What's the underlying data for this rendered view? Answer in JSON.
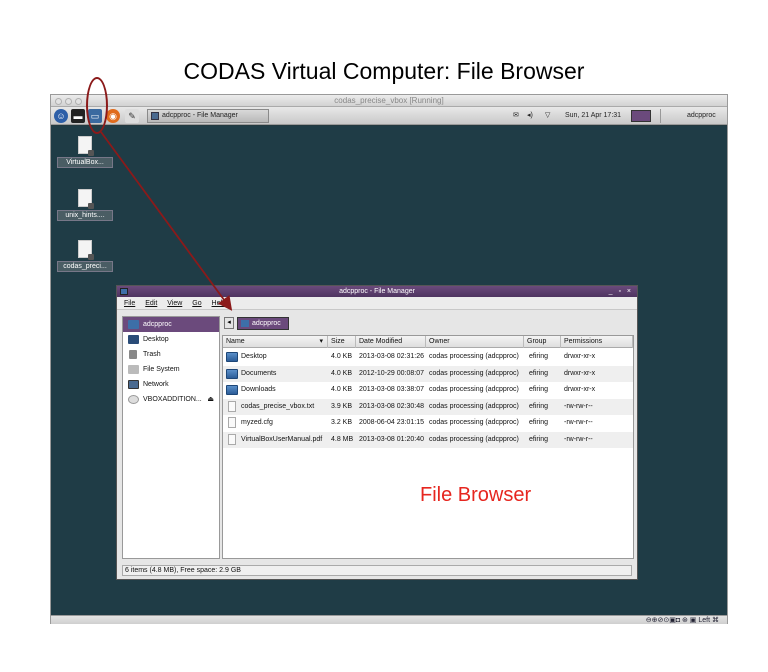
{
  "slide_title": "CODAS Virtual Computer: File Browser",
  "vbox": {
    "title": "codas_precise_vbox [Running]",
    "status_text": "Left ⌘"
  },
  "panel": {
    "task_button": "adcpproc - File Manager",
    "datetime": "Sun, 21 Apr 17:31",
    "user": "adcpproc"
  },
  "desktop_icons": [
    {
      "label": "VirtualBox..."
    },
    {
      "label": "unix_hints...."
    },
    {
      "label": "codas_preci..."
    }
  ],
  "file_manager": {
    "title": "adcpproc - File Manager",
    "window_controls": "_ ▫ ×",
    "menu": [
      "File",
      "Edit",
      "View",
      "Go",
      "Help"
    ],
    "back_glyph": "◂",
    "path_button": "adcpproc",
    "sidebar": [
      {
        "label": "adcpproc",
        "selected": true
      },
      {
        "label": "Desktop"
      },
      {
        "label": "Trash"
      },
      {
        "label": "File System"
      },
      {
        "label": "Network"
      },
      {
        "label": "VBOXADDITION...",
        "eject": "⏏"
      }
    ],
    "columns": [
      "Name",
      "Size",
      "Date Modified",
      "Owner",
      "Group",
      "Permissions"
    ],
    "sort_indicator": "▾",
    "files": [
      {
        "name": "Desktop",
        "type": "folder",
        "size": "4.0 KB",
        "modified": "2013-03-08 02:31:26",
        "owner": "codas processing (adcpproc)",
        "group": "efiring",
        "perms": "drwxr-xr-x"
      },
      {
        "name": "Documents",
        "type": "folder",
        "size": "4.0 KB",
        "modified": "2012-10-29 00:08:07",
        "owner": "codas processing (adcpproc)",
        "group": "efiring",
        "perms": "drwxr-xr-x"
      },
      {
        "name": "Downloads",
        "type": "folder",
        "size": "4.0 KB",
        "modified": "2013-03-08 03:38:07",
        "owner": "codas processing (adcpproc)",
        "group": "efiring",
        "perms": "drwxr-xr-x"
      },
      {
        "name": "codas_precise_vbox.txt",
        "type": "file",
        "size": "3.9 KB",
        "modified": "2013-03-08 02:30:48",
        "owner": "codas processing (adcpproc)",
        "group": "efiring",
        "perms": "-rw-rw-r--"
      },
      {
        "name": "myzed.cfg",
        "type": "file",
        "size": "3.2 KB",
        "modified": "2008-06-04 23:01:15",
        "owner": "codas processing (adcpproc)",
        "group": "efiring",
        "perms": "-rw-rw-r--"
      },
      {
        "name": "VirtualBoxUserManual.pdf",
        "type": "file",
        "size": "4.8 MB",
        "modified": "2013-03-08 01:20:40",
        "owner": "codas processing (adcpproc)",
        "group": "efiring",
        "perms": "-rw-rw-r--"
      }
    ],
    "statusbar": "6 items (4.8 MB), Free space: 2.9 GB"
  },
  "annotation": "File Browser",
  "colors": {
    "accent": "#6b4a7c",
    "desktop": "#1f3c46",
    "annotation": "#e6261f"
  }
}
